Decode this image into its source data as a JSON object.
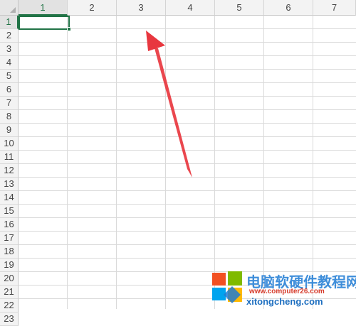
{
  "spreadsheet": {
    "columns": [
      "1",
      "2",
      "3",
      "4",
      "5",
      "6",
      "7"
    ],
    "rows": [
      "1",
      "2",
      "3",
      "4",
      "5",
      "6",
      "7",
      "8",
      "9",
      "10",
      "11",
      "12",
      "13",
      "14",
      "15",
      "16",
      "17",
      "18",
      "19",
      "20",
      "21",
      "22",
      "23"
    ],
    "active_column": "1",
    "active_row": "1",
    "selected_cell": "R1C1"
  },
  "annotation": {
    "type": "arrow",
    "color": "#e8373f"
  },
  "watermark": {
    "title": "电脑软硬件教程网",
    "url_primary": "www.computer26.com",
    "url_secondary": "xitongcheng.com"
  },
  "colors": {
    "selection": "#217346",
    "header_bg": "#f3f3f3",
    "gridline": "#dadada"
  }
}
